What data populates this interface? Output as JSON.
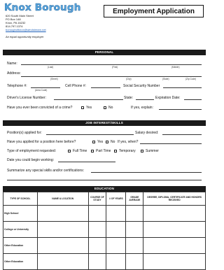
{
  "header": {
    "org_name": "Knox Borough",
    "address_line1": "620 South Main Street",
    "address_line2": "PO Box 148",
    "address_line3": "Knox, PA 16232",
    "phone": "814.797.1374",
    "email": "boroughofknox@windstream.net",
    "eeo": "An equal opportunity employer",
    "form_title": "Employment Application"
  },
  "personal": {
    "section_title": "PERSONAL",
    "name_label": "Name:",
    "name_sub": [
      "(Last)",
      "(First)",
      "(Middle)"
    ],
    "address_label": "Address:",
    "address_sub": [
      "(Street)",
      "(City)",
      "(State)",
      "(Zip Code)"
    ],
    "telephone_label": "Telephone #:",
    "area_code_sub": "(Area Code)",
    "cell_label": "Cell Phone #:",
    "ssn_label": "Social Security Number",
    "license_label": "Driver's License Number:",
    "state_label": "State:",
    "expiration_label": "Expiration Date:",
    "crime_label": "Have you ever been convicted of a crime?",
    "yes_label": "Yes",
    "no_label": "No",
    "explain_label": "If yes, explain:"
  },
  "job": {
    "section_title": "JOB INTEREST/SKILLS",
    "position_label": "Position(s) applied for:",
    "salary_label": "Salary desired:",
    "applied_before_label": "Have you applied for a position here before?",
    "yes_label": "Yes",
    "no_label": "No",
    "when_label": "If yes, when?",
    "type_label": "Type of employment requested:",
    "type_options": [
      "Full Time",
      "Part Time",
      "Temporary",
      "Summer"
    ],
    "begin_label": "Date you could begin working:",
    "skills_label": "Summarize any special skills and/or certifications:"
  },
  "education": {
    "section_title": "EDUCATION",
    "columns": [
      "TYPE OF SCHOOL",
      "NAME & LOCATION",
      "COURSE OF STUDY",
      "# OF YEARS",
      "GRADE AVERAGE",
      "DEGREE, DIPLOMA, CERTIFICATE AND HONORS RECEIVED"
    ],
    "rows": [
      "High School",
      "College or University",
      "Other Education",
      "Other Education"
    ]
  }
}
